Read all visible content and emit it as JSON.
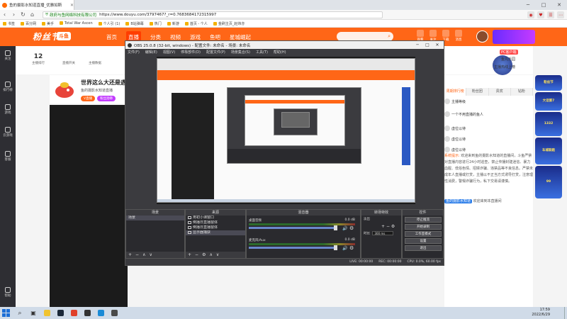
{
  "browser": {
    "tab_title": "鱼的摄影水知道直播_优雅如斯",
    "url_site": "政府与鱼网络科技有限公司",
    "url": "https://www.douyu.com/3797467?_r=0.7683684172315997",
    "bookmarks": [
      "书签",
      "百分网",
      "美乎",
      "Total War Ascen",
      "个人引 (1)",
      "B站弹幕",
      "热门",
      "新游",
      "首页 - 个人",
      "金刷主页_赵炜亦"
    ]
  },
  "site": {
    "logo": "粉丝节",
    "logo2": "斗鱼",
    "nav": [
      "首页",
      "直播",
      "分类",
      "视频",
      "游戏",
      "鱼吧",
      "星城崛起"
    ],
    "active_nav": "直播",
    "header_icons": [
      "观看",
      "关注",
      "下载",
      "消息"
    ]
  },
  "room_stats": [
    {
      "num": "12",
      "label": "主播排行"
    },
    {
      "num": "",
      "label": "直播开关"
    },
    {
      "num": "",
      "label": "主播数据"
    }
  ],
  "streamer": {
    "title": "世界这么大还是遇",
    "name": "鱼的摄影水知道直播",
    "tags": [
      {
        "label": "V直播",
        "color": "#ff6617"
      },
      {
        "label": "粉丝勋章",
        "color": "#c33bff"
      }
    ]
  },
  "sidebar": [
    {
      "label": "关注"
    },
    {
      "label": "排行榜"
    },
    {
      "label": "游戏"
    },
    {
      "label": "云游戏"
    },
    {
      "label": "客服"
    },
    {
      "label": "帮助"
    }
  ],
  "obs": {
    "title": "OBS 25.0.8 (32-bit, windows) - 配置文件: 未命名 - 场景: 未命名",
    "menu": [
      "文件(F)",
      "编辑(E)",
      "视图(V)",
      "停靠部件(D)",
      "配置文件(P)",
      "场景集合(S)",
      "工具(T)",
      "帮助(H)"
    ],
    "panels": {
      "scenes": {
        "title": "场景",
        "items": [
          "场景"
        ]
      },
      "sources": {
        "title": "来源",
        "items": [
          "用初小课窗口",
          "倒播日直播窗体",
          "倒播日直播窗体",
          "显示器捕获"
        ]
      },
      "mixer": {
        "title": "混音器",
        "tracks": [
          {
            "name": "桌面音频",
            "db": "0.0 dB"
          },
          {
            "name": "麦克风/Aux",
            "db": "0.0 dB"
          }
        ]
      },
      "transitions": {
        "title": "转场特效",
        "fade": "淡出",
        "duration_label": "时长",
        "duration": "300 ms"
      },
      "controls": {
        "title": "控件",
        "buttons": [
          "停止推流",
          "开始录制",
          "工作室模式",
          "设置",
          "退出"
        ]
      }
    },
    "status": [
      "LIVE: 00:00:00",
      "REC: 00:00:00",
      "CPU: 0.0%, 60.00 fps"
    ]
  },
  "right_panel": {
    "buttons": [
      "PC客户端",
      "鱼丸乐园",
      "主播热线上榜"
    ],
    "tabs": [
      "周期排行榜",
      "粉丝团",
      "贵宾",
      "钻粉"
    ],
    "chat": [
      {
        "text": "主播等级"
      },
      {
        "text": "一个不用直播的鱼人"
      },
      {
        "text": "虚位以待"
      },
      {
        "text": "虚位以待"
      },
      {
        "text": "虚位以待"
      }
    ],
    "notice_prefix": "系统提示:",
    "notice": "欢迎来到鱼的摄影水知道的直播间，斗鱼严禁对直播内容进行24小时巡查，禁止传播封建迷信、暴力血腥、低俗色情、招嫖诈骗、违禁品等不良信息。严禁未成年人直播或打赏，主播以不正当方式诱导打赏，注意理性消费，警惕诈骗行为，私下交易请谨慎。",
    "welcome": "欢迎来到本直播间",
    "user_card": "鱼的摄影水知道"
  },
  "events": [
    "粉丝节",
    "大话第7",
    "1332",
    "车城联跑",
    "99"
  ],
  "taskbar": {
    "time": "17:59",
    "date": "2022/6/29",
    "apps": [
      {
        "name": "file-explorer",
        "color": "#f0c330"
      },
      {
        "name": "steam",
        "color": "#1b2838"
      },
      {
        "name": "browser-360",
        "color": "#e0402a"
      },
      {
        "name": "obs",
        "color": "#333"
      },
      {
        "name": "edge",
        "color": "#1b8bd6"
      },
      {
        "name": "terminal",
        "color": "#4a4a4a"
      }
    ]
  }
}
